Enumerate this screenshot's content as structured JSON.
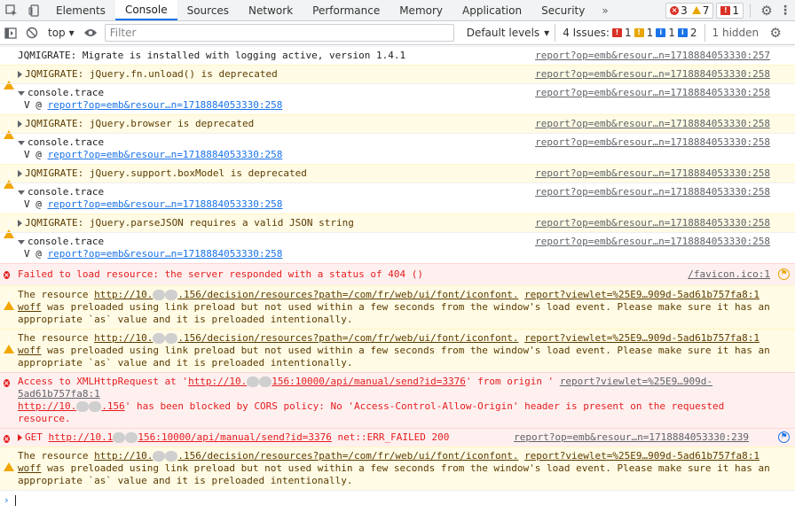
{
  "tabs": [
    "Elements",
    "Console",
    "Sources",
    "Network",
    "Performance",
    "Memory",
    "Application",
    "Security"
  ],
  "active_tab": "Console",
  "more_tabs": "»",
  "counters": {
    "errors": "3",
    "warnings": "7",
    "issues": "1"
  },
  "toolbar": {
    "context": "top",
    "filter_placeholder": "Filter",
    "levels": "Default levels",
    "issues_label": "4 Issues:",
    "issues_error": "1",
    "issues_warn": "1",
    "issues_info": "1",
    "issues_info2": "2",
    "hidden": "1 hidden"
  },
  "messages": [
    {
      "type": "log",
      "text": "JQMIGRATE: Migrate is installed with logging active, version 1.4.1",
      "source": "report?op=emb&resour…n=1718884053330:257"
    },
    {
      "type": "warn",
      "text": "JQMIGRATE: jQuery.fn.unload() is deprecated",
      "source": "report?op=emb&resour…n=1718884053330:258"
    },
    {
      "type": "trace",
      "text": "console.trace",
      "source": "report?op=emb&resour…n=1718884053330:258",
      "frame_prefix": "V @ ",
      "frame": "report?op=emb&resour…n=1718884053330:258"
    },
    {
      "type": "warn",
      "text": "JQMIGRATE: jQuery.browser is deprecated",
      "source": "report?op=emb&resour…n=1718884053330:258"
    },
    {
      "type": "trace",
      "text": "console.trace",
      "source": "report?op=emb&resour…n=1718884053330:258",
      "frame_prefix": "V @ ",
      "frame": "report?op=emb&resour…n=1718884053330:258"
    },
    {
      "type": "warn",
      "text": "JQMIGRATE: jQuery.support.boxModel is deprecated",
      "source": "report?op=emb&resour…n=1718884053330:258"
    },
    {
      "type": "trace",
      "text": "console.trace",
      "source": "report?op=emb&resour…n=1718884053330:258",
      "frame_prefix": "V @ ",
      "frame": "report?op=emb&resour…n=1718884053330:258"
    },
    {
      "type": "warn",
      "text": "JQMIGRATE: jQuery.parseJSON requires a valid JSON string",
      "source": "report?op=emb&resour…n=1718884053330:258"
    },
    {
      "type": "trace",
      "text": "console.trace",
      "source": "report?op=emb&resour…n=1718884053330:258",
      "frame_prefix": "V @ ",
      "frame": "report?op=emb&resour…n=1718884053330:258"
    }
  ],
  "error_404": {
    "text": "Failed to load resource: the server responded with a status of 404 ()",
    "source": "/favicon.ico:1"
  },
  "preload_warning": {
    "prefix": "The resource ",
    "url_a": "http://10.",
    "url_b": ".156/decision/resources?path=/com/fr/web/ui/font/iconfont.",
    "url_c": "woff",
    "rest": " was preloaded using link preload but not used within a few seconds from the window's load event. Please make sure it has an appropriate `as` value and it is preloaded intentionally.",
    "source": "report?viewlet=%25E9…909d-5ad61b757fa8:1"
  },
  "cors_error": {
    "prefix": "Access to XMLHttpRequest at '",
    "url": "http://10.",
    "url_tail": "156:10000/api/manual/send?id=3376",
    "mid": "' from origin '",
    "origin": "http://10.",
    "origin_tail": ".156",
    "rest": "' has been blocked by CORS policy: No 'Access-Control-Allow-Origin' header is present on the requested resource.",
    "source": "report?viewlet=%25E9…909d-5ad61b757fa8:1"
  },
  "get_error": {
    "prefix": "GET ",
    "url": "http://10.1",
    "url_tail": "156:10000/api/manual/send?id=3376",
    "rest": " net::ERR_FAILED 200",
    "source": "report?op=emb&resour…n=1718884053330:239"
  },
  "prompt": "›"
}
